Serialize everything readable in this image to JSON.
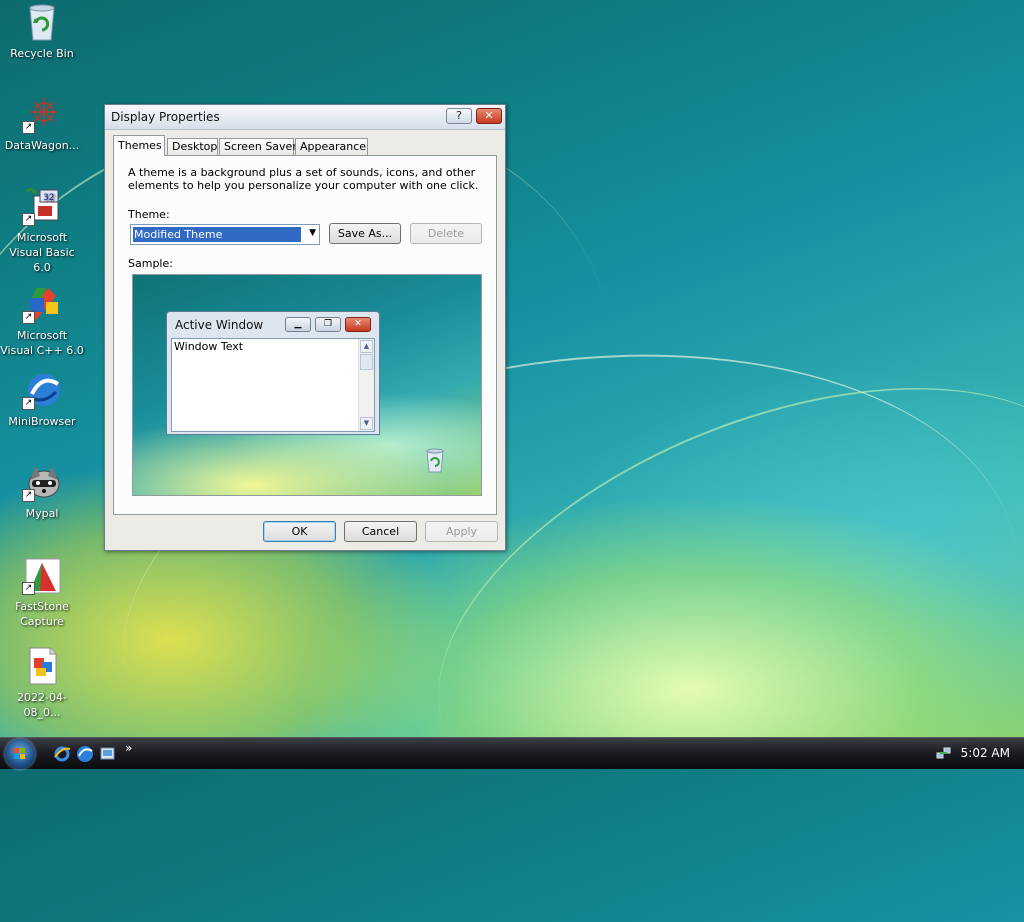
{
  "desktop": {
    "icons": [
      {
        "name": "recycle-bin",
        "label": "Recycle Bin"
      },
      {
        "name": "datawagon",
        "label": "DataWagon..."
      },
      {
        "name": "visual-basic",
        "label": "Microsoft Visual Basic 6.0"
      },
      {
        "name": "visual-cpp",
        "label": "Microsoft Visual C++ 6.0"
      },
      {
        "name": "minibrowser",
        "label": "MiniBrowser"
      },
      {
        "name": "mypal",
        "label": "Mypal"
      },
      {
        "name": "faststone",
        "label": "FastStone Capture"
      },
      {
        "name": "screenshot-file",
        "label": "2022-04-08_0..."
      }
    ]
  },
  "dialog": {
    "title": "Display Properties",
    "help_label": "?",
    "close_label": "✕",
    "tabs": [
      "Themes",
      "Desktop",
      "Screen Saver",
      "Appearance"
    ],
    "active_tab": "Themes",
    "description": "A theme is a background plus a set of sounds, icons, and other elements to help you personalize your computer with one click.",
    "theme_label": "Theme:",
    "theme_value": "Modified Theme",
    "save_as_label": "Save As...",
    "delete_label": "Delete",
    "sample_label": "Sample:",
    "sample": {
      "window_title": "Active Window",
      "window_text": "Window Text"
    },
    "ok_label": "OK",
    "cancel_label": "Cancel",
    "apply_label": "Apply"
  },
  "taskbar": {
    "more_label": "»",
    "clock": "5:02 AM"
  }
}
